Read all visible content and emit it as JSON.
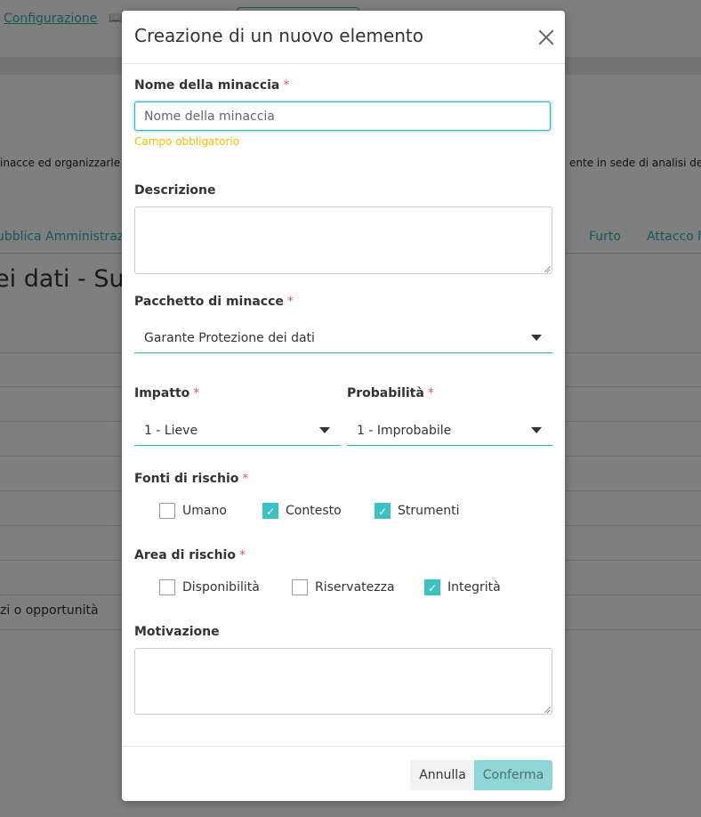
{
  "background": {
    "top_link": "Configurazione",
    "description_left": "inacce ed organizzarle in",
    "description_right": "ente in sede di analisi del ri",
    "tabs": [
      "ubblica Amministrazio",
      "Furto",
      "Attacco h"
    ],
    "heading": "ei dati - Su e",
    "row_text": "zi o opportunità"
  },
  "modal": {
    "title": "Creazione di un nuovo elemento",
    "required_mark": "*",
    "name_field": {
      "label": "Nome della minaccia",
      "placeholder": "Nome della minaccia",
      "value": "",
      "hint": "Campo obbligatorio"
    },
    "description": {
      "label": "Descrizione",
      "value": ""
    },
    "package": {
      "label": "Pacchetto di minacce",
      "selected": "Garante Protezione dei dati"
    },
    "impact": {
      "label": "Impatto",
      "selected": "1 - Lieve"
    },
    "probability": {
      "label": "Probabilità",
      "selected": "1 - Improbabile"
    },
    "risk_sources": {
      "label": "Fonti di rischio",
      "options": [
        {
          "label": "Umano",
          "checked": false
        },
        {
          "label": "Contesto",
          "checked": true
        },
        {
          "label": "Strumenti",
          "checked": true
        }
      ]
    },
    "risk_area": {
      "label": "Area di rischio",
      "options": [
        {
          "label": "Disponibilità",
          "checked": false
        },
        {
          "label": "Riservatezza",
          "checked": false
        },
        {
          "label": "Integrità",
          "checked": true
        }
      ]
    },
    "motivation": {
      "label": "Motivazione",
      "value": ""
    },
    "footer": {
      "cancel_label": "Annulla",
      "confirm_label": "Conferma"
    }
  },
  "colors": {
    "accent": "#26b3b3",
    "checkbox_on": "#3dc1c1",
    "required": "#e05a5a",
    "hint": "#f0c000",
    "confirm_bg": "#8fd7d7"
  },
  "icons": {
    "close": "close-icon",
    "caret": "caret-down-icon",
    "check": "checkmark-icon"
  }
}
